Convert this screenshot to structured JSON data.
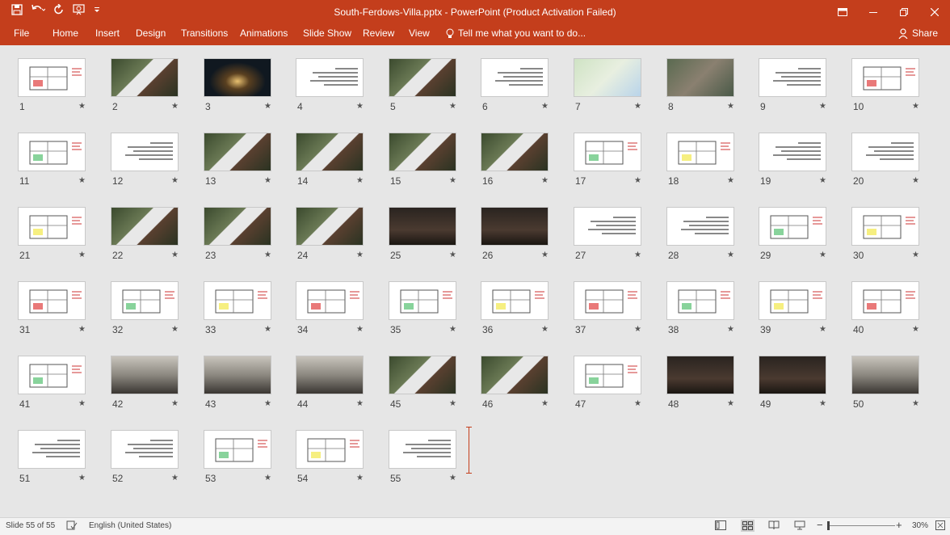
{
  "window": {
    "title": "South-Ferdows-Villa.pptx - PowerPoint (Product Activation Failed)"
  },
  "qat": {
    "icons": [
      "save-icon",
      "undo-icon",
      "redo-icon",
      "present-icon",
      "customize-icon"
    ]
  },
  "ribbon": {
    "tabs": [
      "File",
      "Home",
      "Insert",
      "Design",
      "Transitions",
      "Animations",
      "Slide Show",
      "Review",
      "View"
    ],
    "tell_me": "Tell me what you want to do...",
    "share": "Share"
  },
  "slides": [
    "1",
    "2",
    "3",
    "4",
    "5",
    "6",
    "7",
    "8",
    "9",
    "10",
    "11",
    "12",
    "13",
    "14",
    "15",
    "16",
    "17",
    "18",
    "19",
    "20",
    "21",
    "22",
    "23",
    "24",
    "25",
    "26",
    "27",
    "28",
    "29",
    "30",
    "31",
    "32",
    "33",
    "34",
    "35",
    "36",
    "37",
    "38",
    "39",
    "40",
    "41",
    "42",
    "43",
    "44",
    "45",
    "46",
    "47",
    "48",
    "49",
    "50",
    "51",
    "52",
    "53",
    "54",
    "55"
  ],
  "star_glyph": "★",
  "status": {
    "slide_info": "Slide 55 of 55",
    "language": "English (United States)",
    "zoom": "30%"
  }
}
